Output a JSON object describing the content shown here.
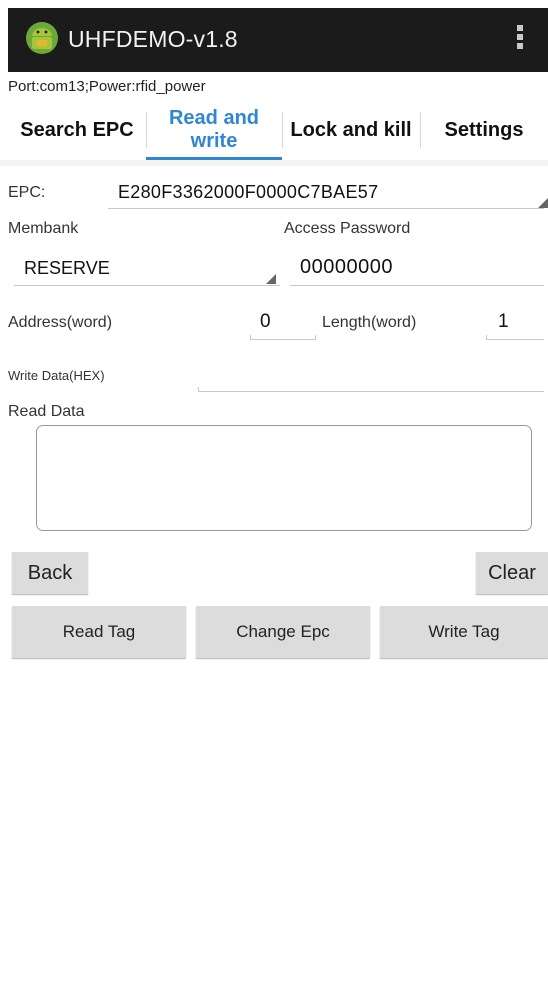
{
  "app": {
    "title": "UHFDEMO-v1.8",
    "icon": "android-app-icon",
    "menu_icon": "overflow-menu-icon",
    "bar_color": "#1b1b1b"
  },
  "port_info": "Port:com13;Power:rfid_power",
  "tabs": [
    {
      "label": "Search EPC",
      "active": false
    },
    {
      "label": "Read and write",
      "active": true
    },
    {
      "label": "Lock and kill",
      "active": false
    },
    {
      "label": "Settings",
      "active": false
    }
  ],
  "accent_color": "#2f86d4",
  "form": {
    "epc_label": "EPC:",
    "epc_value": "E280F3362000F0000C7BAE57",
    "membank_label": "Membank",
    "membank_value": "RESERVE",
    "access_password_label": "Access Password",
    "access_password_value": "00000000",
    "address_label": "Address(word)",
    "address_value": "0",
    "length_label": "Length(word)",
    "length_value": "1",
    "write_data_label": "Write Data(HEX)",
    "write_data_value": "",
    "read_data_label": "Read Data",
    "read_data_value": ""
  },
  "buttons": {
    "back": "Back",
    "clear": "Clear",
    "read_tag": "Read Tag",
    "change_epc": "Change Epc",
    "write_tag": "Write Tag"
  }
}
